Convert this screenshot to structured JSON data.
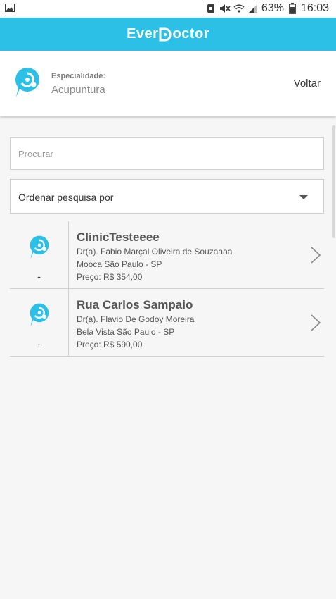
{
  "status_bar": {
    "battery_percent": "63%",
    "clock": "16:03"
  },
  "app_bar": {
    "brand_left": "Ever",
    "brand_right": "octor"
  },
  "specialty": {
    "label": "Especialidade:",
    "value": "Acupuntura",
    "back_label": "Voltar"
  },
  "search": {
    "placeholder": "Procurar",
    "value": ""
  },
  "sort": {
    "label": "Ordenar pesquisa por"
  },
  "results": [
    {
      "name": "ClinicTesteeee",
      "doctor": "Dr(a). Fabio Marçal Oliveira de Souzaaaa",
      "location": "Mooca São Paulo - SP",
      "price": "Preço: R$ 354,00",
      "rating": "-"
    },
    {
      "name": "Rua Carlos Sampaio",
      "doctor": "Dr(a). Flavio De Godoy Moreira",
      "location": "Bela Vista São Paulo - SP",
      "price": "Preço: R$ 590,00",
      "rating": "-"
    }
  ],
  "colors": {
    "brand": "#2dc0e6",
    "background": "#f6f6f7"
  }
}
